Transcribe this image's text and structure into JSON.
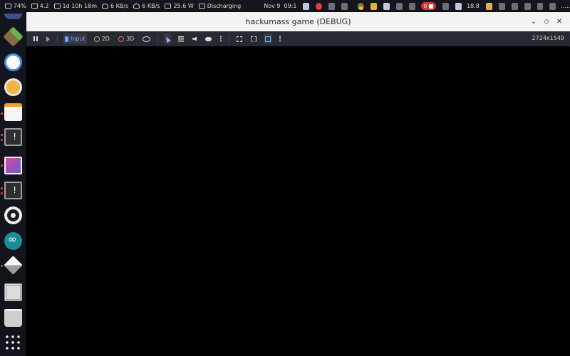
{
  "top_panel": {
    "battery": "74%",
    "load": "4.2",
    "uptime": "1d 10h 18m",
    "download": "6 KB/s",
    "upload": "6 KB/s",
    "power": "25.6 W",
    "power_state": "Discharging",
    "date": "Nov 9",
    "time": "09:1",
    "recording": "0",
    "temperature": "18.8",
    "overflow": "....."
  },
  "window": {
    "title": "hackumass game (DEBUG)",
    "controls": {
      "minimize": "⌄",
      "maximize": "◇",
      "close": "✕"
    }
  },
  "toolbar": {
    "input_label": "Input",
    "mode_2d": "2D",
    "mode_3d": "3D",
    "resolution": "2724x1549"
  },
  "dock": {
    "apps": [
      "minecraft-icon",
      "xcode-icon",
      "updater-icon",
      "notes-icon",
      "terminal-icon",
      "paint-icon",
      "terminal-icon",
      "settings-gear-icon",
      "arduino-icon",
      "cube-icon",
      "chip-icon",
      "trash-icon",
      "app-grid-icon"
    ]
  },
  "colors": {
    "panel_bg": "#15161d",
    "titlebar_bg": "#f2f2f2",
    "toolbar_bg": "#272a31",
    "viewport_bg": "#000000",
    "accent_blue": "#6aa6ff"
  }
}
